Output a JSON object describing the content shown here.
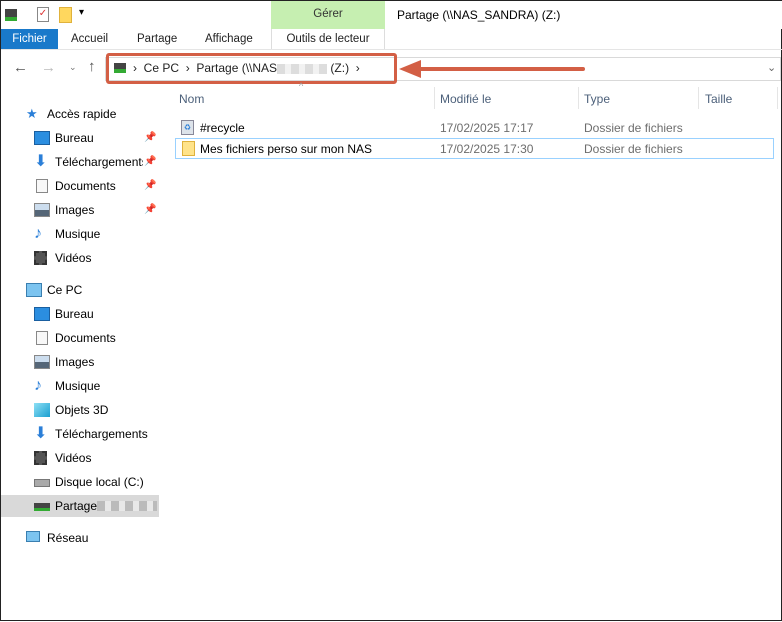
{
  "window": {
    "title": "Partage (\\\\NAS_SANDRA) (Z:)"
  },
  "ribbon": {
    "context_group": "Gérer",
    "tabs": [
      "Fichier",
      "Accueil",
      "Partage",
      "Affichage",
      "Outils de lecteur"
    ],
    "accent": "#1979ca",
    "context_color": "#c6efb1"
  },
  "address": {
    "crumbs": [
      "Ce PC",
      "Partage (\\\\NAS",
      "(Z:)"
    ],
    "highlight_color": "#d35f45"
  },
  "columns": [
    "Nom",
    "Modifié le",
    "Type",
    "Taille"
  ],
  "files": [
    {
      "name": "#recycle",
      "modified": "17/02/2025 17:17",
      "type": "Dossier de fichiers",
      "size": "",
      "icon": "recycle-bin-icon"
    },
    {
      "name": "Mes fichiers perso sur mon NAS",
      "modified": "17/02/2025 17:30",
      "type": "Dossier de fichiers",
      "size": "",
      "icon": "folder-icon"
    }
  ],
  "sidebar": {
    "quick_access": {
      "label": "Accès rapide",
      "items": [
        "Bureau",
        "Téléchargements",
        "Documents",
        "Images",
        "Musique",
        "Vidéos"
      ]
    },
    "this_pc": {
      "label": "Ce PC",
      "items": [
        "Bureau",
        "Documents",
        "Images",
        "Musique",
        "Objets 3D",
        "Téléchargements",
        "Vidéos",
        "Disque local (C:)",
        "Partage"
      ]
    },
    "network": "Réseau"
  }
}
